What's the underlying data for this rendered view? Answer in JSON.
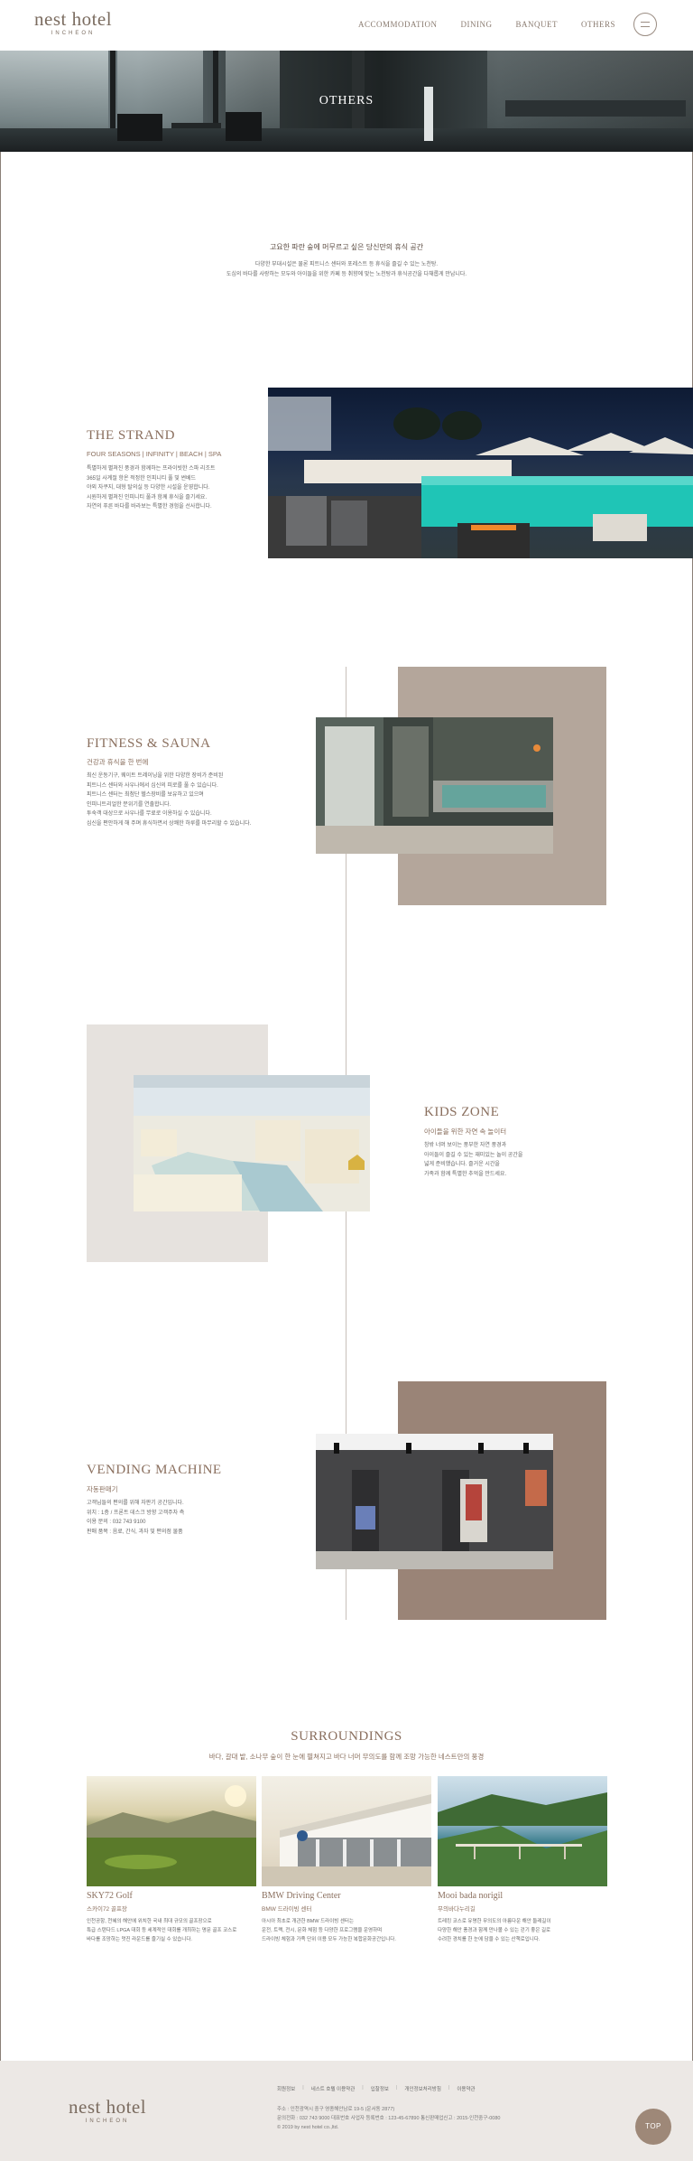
{
  "header": {
    "logo": "nest hotel",
    "logo_sub": "INCHEON",
    "nav": [
      "ACCOMMODATION",
      "DINING",
      "BANQUET",
      "OTHERS"
    ]
  },
  "hero": {
    "title": "OTHERS"
  },
  "intro": {
    "title": "고요한 파란 숲에 머무르고 싶은 당신만의 휴식 공간",
    "lines": [
      "다양한 부대시설은 물론 피트니스 센터와 포레스트 등 휴식을 즐길 수 있는 노천탕.",
      "도심의 바다를 사랑하는 모두와 아이들을 위한 카페 등 취향에 맞는 노천탕과 휴식공간을 다채롭게 만납니다."
    ]
  },
  "sections": {
    "strand": {
      "title": "THE STRAND",
      "subtitle": "FOUR SEASONS | INFINITY | BEACH | SPA",
      "desc": [
        "특별하게 펼쳐진 풍경과 함께하는 프라이빗한 스파 리조트",
        "365일 사계절 항온 적정한 인피니티 풀 및 썬베드",
        "야외 자쿠지, 대형 탈의실 등 다양한 시설을 운영합니다.",
        "시원하게 펼쳐진 인피니티 풀과 함께 휴식을 즐기세요.",
        "자연의 푸른 바다를 바라보는 특별한 경험을 선사합니다."
      ]
    },
    "fitness": {
      "title": "FITNESS & SAUNA",
      "subtitle": "건강과 휴식을 한 번에",
      "desc": [
        "최신 운동기구, 웨이트 트레이닝을 위한 다양한 장비가 준비된",
        "피트니스 센터와 사우나에서 심신의 피로를 풀 수 있습니다.",
        "피트니스 센터는 최첨단 헬스장비를 보유하고 있으며",
        "인피니트리얼한 분위기를 연출합니다.",
        "투숙객 대상으로 사우나를 무료로 이용하실 수 있습니다.",
        "심신을 편안하게 해 주며 휴식하면서 상쾌한 하루를 마무리할 수 있습니다."
      ]
    },
    "kids": {
      "title": "KIDS ZONE",
      "subtitle": "아이들을 위한 자연 속 놀이터",
      "desc": [
        "창밖 너머 보이는 풍부한 자연 풍경과",
        "아이들이 즐길 수 있는 재미있는 놀이 공간을",
        "넓게 준비했습니다. 즐거운 시간을",
        "가족과 함께 특별한 추억을 만드세요."
      ]
    },
    "vending": {
      "title": "VENDING MACHINE",
      "subtitle": "자동판매기",
      "desc": [
        "고객님들의 편의를 위해 자판기 공간입니다.",
        "위치 : 1층 / 프론트 데스크 방향 고객주차 측",
        "이용 문의 : 032 743 9100",
        "판매 품목 : 음료, 간식, 과자 및 편의점 물품"
      ]
    }
  },
  "surroundings": {
    "title": "SURROUNDINGS",
    "subtitle": "바다, 갈대 밭, 소나무 숲이 한 눈에 펼쳐지고 바다 너머 무의도를 함께 조망 가능한 네스트만의 풍경",
    "cards": [
      {
        "title": "SKY72 Golf",
        "subtitle": "스카이72 골프장",
        "desc": [
          "인천공항, 천혜의 해안에 위치한 국내 최대 규모의 골프장으로",
          "특급 스탠다드 LPGA 대회 등 세계적인 대회를 개최하는 명문 골프 코스로",
          "바다를 조망하는 멋진 라운드를 즐기실 수 있습니다."
        ]
      },
      {
        "title": "BMW Driving Center",
        "subtitle": "BMW 드라이빙 센터",
        "desc": [
          "아시아 최초로 개관한 BMW 드라이빙 센터는",
          "운전, 트랙, 전시, 문화 체험 등 다양한 프로그램을 운영하며",
          "드라이빙 체험과 가족 단위 이용 모두 가능한 복합문화공간입니다."
        ]
      },
      {
        "title": "Mooi bada norigil",
        "subtitle": "무의바다누리길",
        "desc": [
          "트레킹 코스로 유명한 무의도의 아름다운 해안 둘레길이",
          "다양한 해안 풍경과 함께 만나볼 수 있는 걷기 좋은 길로",
          "수려한 경치를 한 눈에 담을 수 있는 산책로입니다."
        ]
      }
    ]
  },
  "footer": {
    "logo": "nest hotel",
    "logo_sub": "INCHEON",
    "links": [
      "회원정보",
      "네스트 호텔 이용약관",
      "입찰정보",
      "개인정보처리방침",
      "이용약관"
    ],
    "info": [
      "주소 : 인천광역시 중구 영종해안남로 19-5 (운서동 2877)",
      "문의전화 : 032 743 9000 대표번호 사업자 등록번호 : 123-45-67890 통신판매업신고 : 2015-인천중구-0080",
      "© 2019 by nest hotel co.,ltd."
    ]
  },
  "top_button": "TOP",
  "colors": {
    "accent": "#8a6f5e",
    "beige_block": "#b4a69b",
    "light_block": "#e6e2de",
    "brown_block": "#9a8477",
    "footer_bg": "#ece8e5",
    "top_button": "#9e8878"
  }
}
